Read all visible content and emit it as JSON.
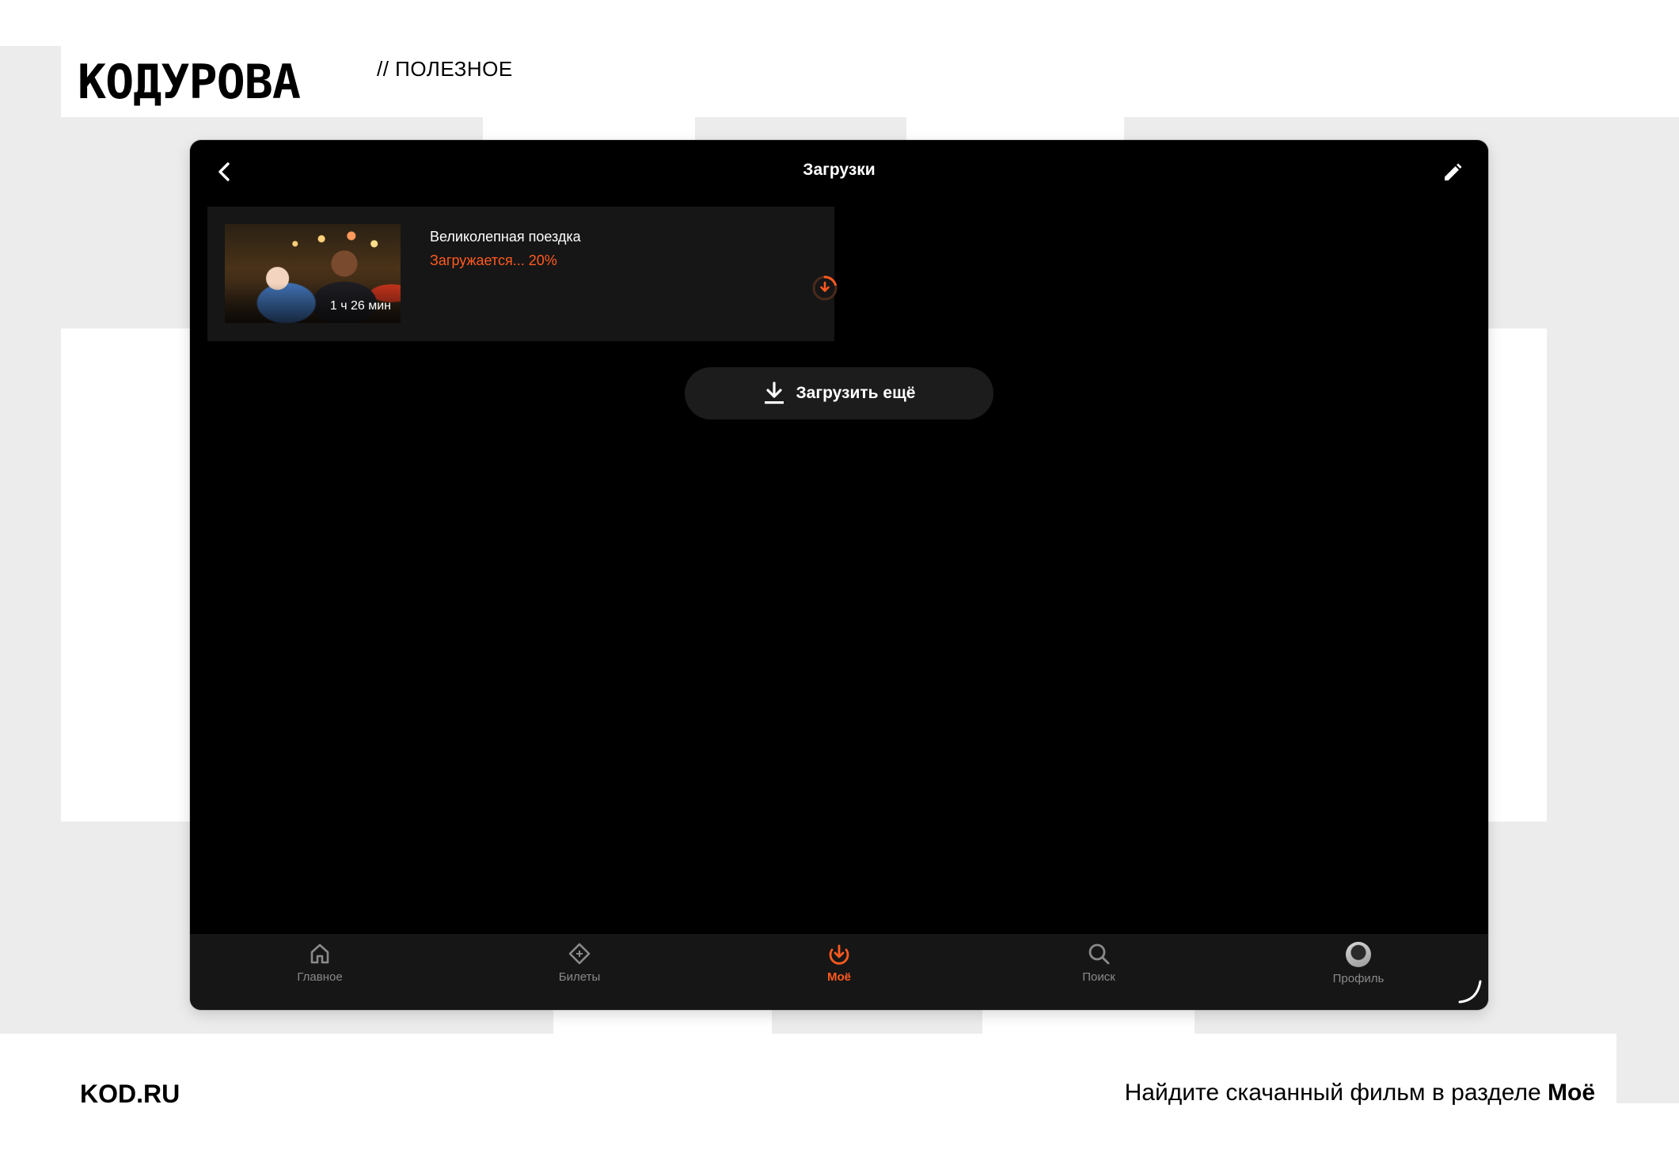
{
  "brand": {
    "logo_text": "KOДУРОВА",
    "section_tag": "// ПОЛЕЗНОЕ"
  },
  "app": {
    "title": "Загрузки",
    "downloads": [
      {
        "title": "Великолепная поездка",
        "status": "Загружается... 20%",
        "progress_percent": 20,
        "duration": "1 ч 26 мин"
      }
    ],
    "load_more_label": "Загрузить ещё",
    "tabs": [
      {
        "id": "home",
        "label": "Главное",
        "active": false,
        "icon": "home-icon"
      },
      {
        "id": "tickets",
        "label": "Билеты",
        "active": false,
        "icon": "ticket-icon"
      },
      {
        "id": "mine",
        "label": "Моё",
        "active": true,
        "icon": "my-downloads-icon"
      },
      {
        "id": "search",
        "label": "Поиск",
        "active": false,
        "icon": "search-icon"
      },
      {
        "id": "profile",
        "label": "Профиль",
        "active": false,
        "icon": "avatar"
      }
    ],
    "colors": {
      "accent": "#ff5a1f",
      "background": "#000000",
      "card": "#161616",
      "inactive_tab": "#8a8a8a"
    }
  },
  "footer": {
    "site": "KOD.RU",
    "caption_prefix": "Найдите скачанный фильм в разделе",
    "caption_emphasis": "Моё"
  }
}
